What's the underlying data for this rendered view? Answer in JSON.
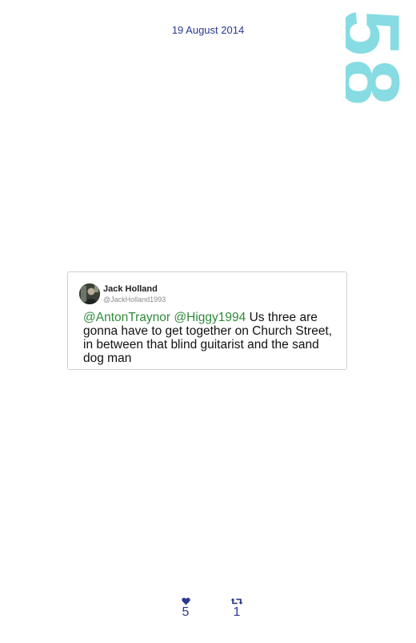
{
  "date": "19 August 2014",
  "page_number": "58",
  "tweet": {
    "author_name": "Jack Holland",
    "author_handle": "@JackHolland1993",
    "mentions": [
      "@AntonTraynor",
      "@Higgy1994"
    ],
    "body": "Us three are gonna have to get together on Church Street, in between that blind guitarist and the sand dog man"
  },
  "stats": {
    "likes": "5",
    "retweets": "1"
  },
  "colors": {
    "accent": "#2b3990",
    "page_number": "#86dce2",
    "mention": "#2e8b3a"
  },
  "icons": {
    "likes": "heart-icon",
    "retweets": "retweet-icon"
  }
}
